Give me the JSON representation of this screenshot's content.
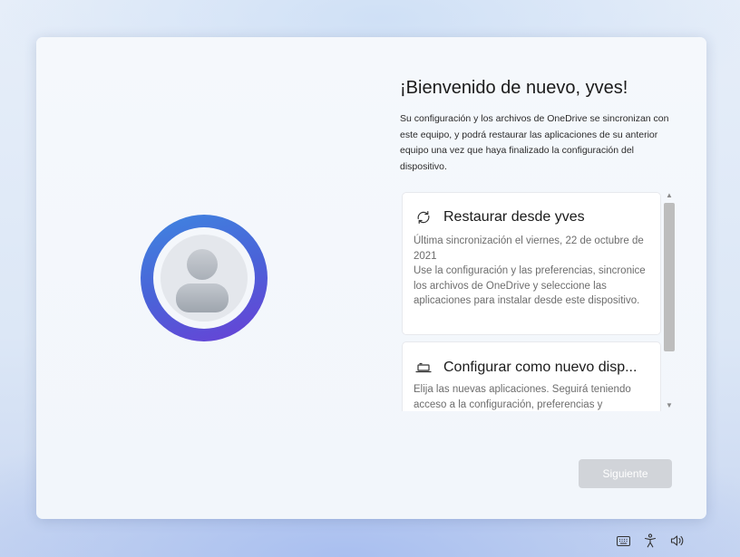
{
  "header": {
    "title": "¡Bienvenido de nuevo, yves!",
    "description": "Su configuración y los archivos de OneDrive se sincronizan con este equipo, y podrá restaurar las aplicaciones de su anterior equipo una vez que haya finalizado la configuración del dispositivo."
  },
  "options": [
    {
      "icon": "sync-icon",
      "title": "Restaurar desde yves",
      "text": "Última sincronización el viernes, 22 de octubre de 2021\nUse la configuración y las preferencias, sincronice los archivos de OneDrive y seleccione las aplicaciones para instalar desde este dispositivo."
    },
    {
      "icon": "laptop-icon",
      "title": "Configurar como nuevo disp...",
      "text": "Elija las nuevas aplicaciones. Seguirá teniendo acceso a la configuración, preferencias y"
    }
  ],
  "footer": {
    "next_label": "Siguiente",
    "next_enabled": false
  },
  "avatar": {
    "icon": "user-avatar-icon",
    "ring_colors": [
      "#3f86e0",
      "#6a3fd6"
    ]
  },
  "taskbar": {
    "icons": [
      "keyboard-icon",
      "accessibility-icon",
      "volume-icon"
    ]
  }
}
